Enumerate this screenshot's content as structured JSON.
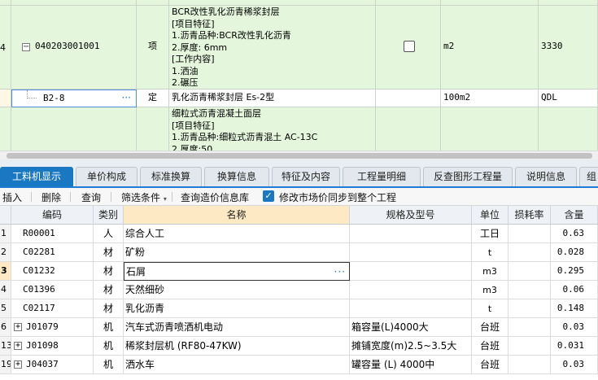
{
  "upper": {
    "row_top": {
      "item_text": ""
    },
    "row_4": {
      "rownum": "4",
      "code": "040203001001",
      "type": "项",
      "desc_lines": [
        "BCR改性乳化沥青稀浆封层",
        "[项目特征]",
        "1.沥青品种:BCR改性乳化沥青",
        "2.厚度: 6mm",
        "[工作内容]",
        "1.洒油",
        "2.碾压"
      ],
      "unit": "m2",
      "qty": "3330"
    },
    "row_b": {
      "code": "B2-8",
      "type": "定",
      "desc": "乳化沥青稀浆封层 Es-2型",
      "unit": "100m2",
      "qty": "QDL"
    },
    "row_c": {
      "desc_lines": [
        "细粒式沥青混凝土面层",
        "[项目特征]",
        "1.沥青品种:细粒式沥青混土 AC-13C",
        "2.厚度:50"
      ]
    }
  },
  "tabs": [
    {
      "label": "工料机显示",
      "active": true
    },
    {
      "label": "单价构成",
      "active": false
    },
    {
      "label": "标准换算",
      "active": false
    },
    {
      "label": "换算信息",
      "active": false
    },
    {
      "label": "特征及内容",
      "active": false
    },
    {
      "label": "工程量明细",
      "active": false
    },
    {
      "label": "反查图形工程量",
      "active": false
    },
    {
      "label": "说明信息",
      "active": false
    },
    {
      "label": "组",
      "active": false
    }
  ],
  "toolbar": {
    "insert": "插入",
    "delete": "删除",
    "query": "查询",
    "filter": "筛选条件",
    "query_price_lib": "查询造价信息库",
    "sync_label": "修改市场价同步到整个工程"
  },
  "lower": {
    "headers": {
      "code": "编码",
      "category": "类别",
      "name": "名称",
      "spec": "规格及型号",
      "unit": "单位",
      "loss": "损耗率",
      "content": "含量"
    },
    "rows": [
      {
        "num": "1",
        "code": "R00001",
        "category": "人",
        "name": "综合人工",
        "spec": "",
        "unit": "工日",
        "loss": "",
        "content": "0.63",
        "expand": false
      },
      {
        "num": "2",
        "code": "C02281",
        "category": "材",
        "name": "矿粉",
        "spec": "",
        "unit": "t",
        "loss": "",
        "content": "0.028",
        "expand": false
      },
      {
        "num": "3",
        "code": "C01232",
        "category": "材",
        "name": "石屑",
        "spec": "",
        "unit": "m3",
        "loss": "",
        "content": "0.295",
        "expand": false,
        "selected": true
      },
      {
        "num": "4",
        "code": "C01396",
        "category": "材",
        "name": "天然细砂",
        "spec": "",
        "unit": "m3",
        "loss": "",
        "content": "0.06",
        "expand": false
      },
      {
        "num": "5",
        "code": "C02117",
        "category": "材",
        "name": "乳化沥青",
        "spec": "",
        "unit": "t",
        "loss": "",
        "content": "0.148",
        "expand": false
      },
      {
        "num": "6",
        "code": "J01079",
        "category": "机",
        "name": "汽车式沥青喷洒机电动",
        "spec": "箱容量(L)4000大",
        "unit": "台班",
        "loss": "",
        "content": "0.03",
        "expand": true
      },
      {
        "num": "13",
        "code": "J01098",
        "category": "机",
        "name": "稀浆封层机 (RF80-47KW)",
        "spec": "摊铺宽度(m)2.5~3.5大",
        "unit": "台班",
        "loss": "",
        "content": "0.031",
        "expand": true
      },
      {
        "num": "19",
        "code": "J04037",
        "category": "机",
        "name": "洒水车",
        "spec": "罐容量 (L) 4000中",
        "unit": "台班",
        "loss": "",
        "content": "0.03",
        "expand": true
      }
    ]
  },
  "colors": {
    "accent": "#1a78c2",
    "green_row": "#e4f6dc",
    "header_highlight": "#fde9c4"
  }
}
